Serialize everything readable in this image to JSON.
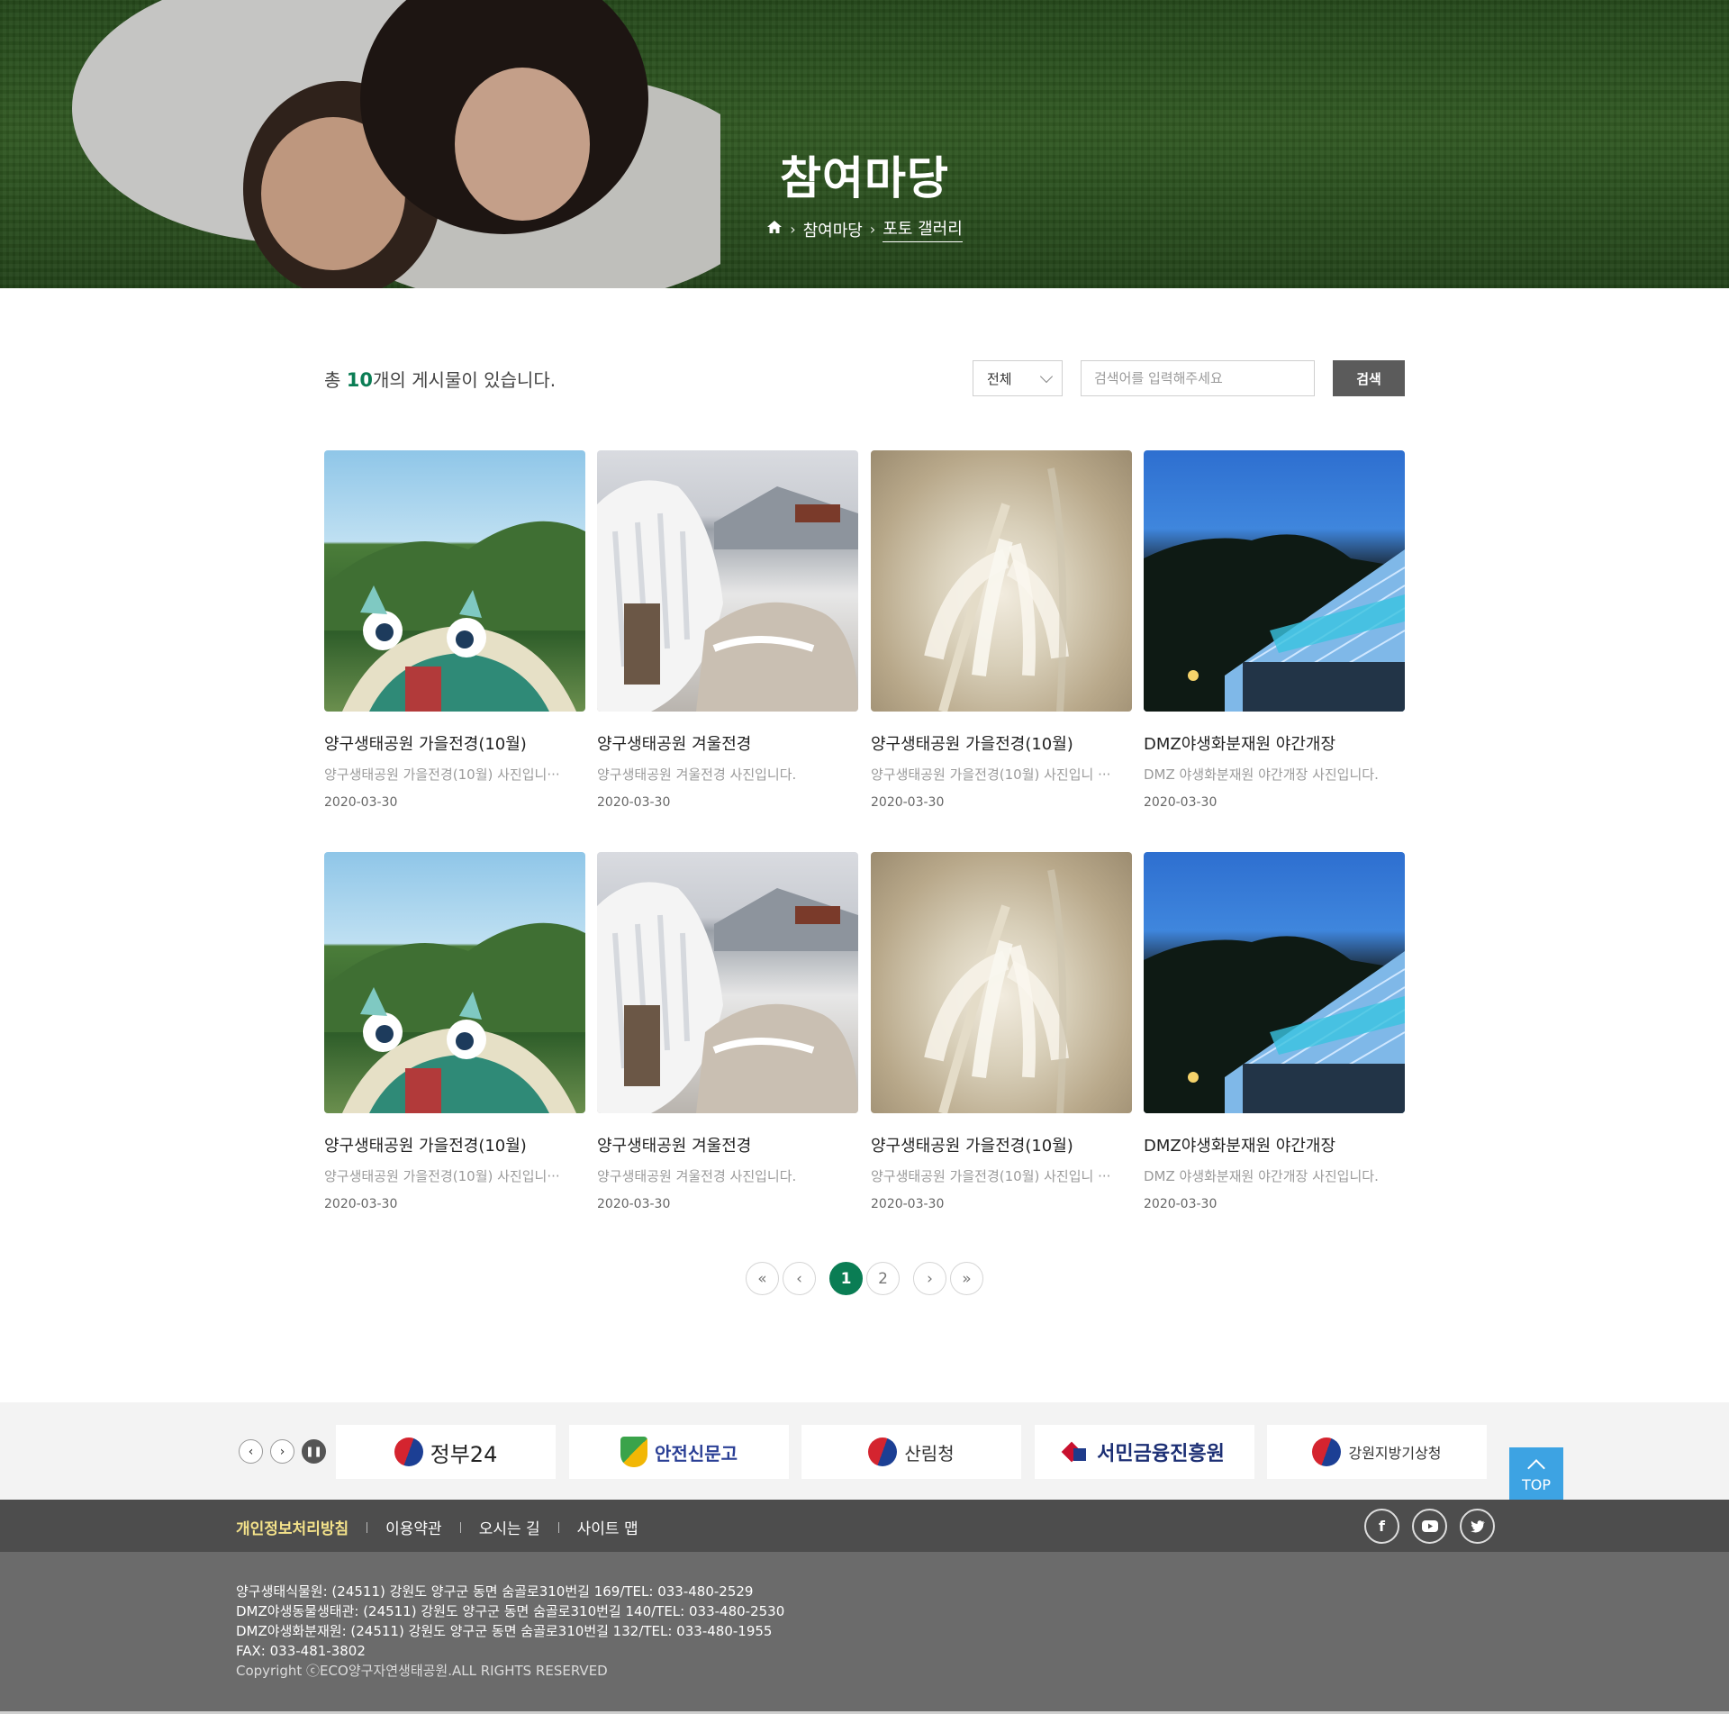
{
  "hero": {
    "title": "참여마당",
    "breadcrumb": [
      "참여마당",
      "포토 갤러리"
    ]
  },
  "board": {
    "total_prefix": "총 ",
    "total_count": "10",
    "total_suffix": "개의 게시물이 있습니다.",
    "filter_selected": "전체",
    "search_placeholder": "검색어를 입력해주세요",
    "search_label": "검색"
  },
  "gallery": [
    {
      "title": "양구생태공원 가을전경(10월)",
      "desc": "양구생태공원 가을전경(10월) 사진입니···",
      "date": "2020-03-30",
      "image": "autumn-park"
    },
    {
      "title": "양구생태공원 겨울전경",
      "desc": "양구생태공원 겨울전경 사진입니다.",
      "date": "2020-03-30",
      "image": "winter-ice"
    },
    {
      "title": "양구생태공원 가을전경(10월)",
      "desc": "양구생태공원 가을전경(10월) 사진입니 ···",
      "date": "2020-03-30",
      "image": "silver-grass"
    },
    {
      "title": "DMZ야생화분재원 야간개장",
      "desc": "DMZ 야생화분재원 야간개장 사진입니다.",
      "date": "2020-03-30",
      "image": "night-greenhouse"
    },
    {
      "title": "양구생태공원 가을전경(10월)",
      "desc": "양구생태공원 가을전경(10월) 사진입니···",
      "date": "2020-03-30",
      "image": "autumn-park"
    },
    {
      "title": "양구생태공원 겨울전경",
      "desc": "양구생태공원 겨울전경 사진입니다.",
      "date": "2020-03-30",
      "image": "winter-ice"
    },
    {
      "title": "양구생태공원 가을전경(10월)",
      "desc": "양구생태공원 가을전경(10월) 사진입니 ···",
      "date": "2020-03-30",
      "image": "silver-grass"
    },
    {
      "title": "DMZ야생화분재원 야간개장",
      "desc": "DMZ 야생화분재원 야간개장 사진입니다.",
      "date": "2020-03-30",
      "image": "night-greenhouse"
    }
  ],
  "pagination": {
    "pages": [
      "1",
      "2"
    ],
    "current": "1"
  },
  "family_sites": [
    {
      "name": "정부24",
      "icon": "taegeuk-icon"
    },
    {
      "name": "안전신문고",
      "icon": "shield-icon"
    },
    {
      "name": "산림청",
      "icon": "taegeuk-icon"
    },
    {
      "name": "서민금융진흥원",
      "icon": "arrow-mark-icon"
    },
    {
      "name": "강원지방기상청",
      "icon": "taegeuk-icon"
    }
  ],
  "top_button": "TOP",
  "footer": {
    "links": [
      "개인정보처리방침",
      "이용약관",
      "오시는 길",
      "사이트 맵"
    ],
    "social": [
      "facebook-icon",
      "youtube-icon",
      "twitter-icon"
    ],
    "lines": [
      "양구생태식물원: (24511) 강원도 양구군 동면 숨골로310번길 169/TEL: 033-480-2529",
      "DMZ야생동물생태관: (24511) 강원도 양구군 동면 숨골로310번길 140/TEL: 033-480-2530",
      "DMZ야생화분재원: (24511) 강원도 양구군 동면 숨골로310번길 132/TEL: 033-480-1955",
      "FAX: 033-481-3802"
    ],
    "copyright": "Copyright ⓒECO양구자연생태공원.ALL RIGHTS RESERVED"
  },
  "colors": {
    "accent": "#0a7d54",
    "search_button": "#5b5b5b",
    "top_button": "#3da3e3",
    "footer_bar": "#4d4d4d",
    "footer_info": "#6b6b6b",
    "footer_highlight": "#f4e28a"
  }
}
